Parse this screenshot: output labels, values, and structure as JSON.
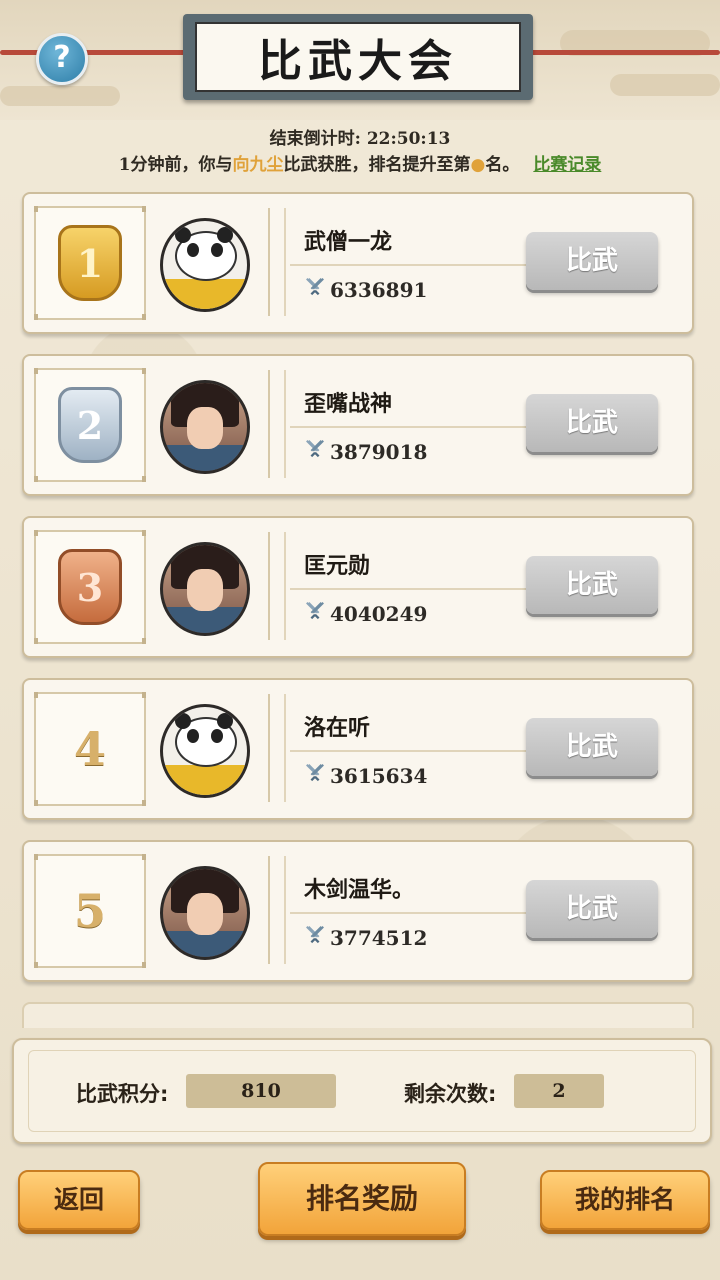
{
  "header": {
    "title": "比武大会",
    "help_label": "?"
  },
  "countdown": {
    "label": "结束倒计时:",
    "time": "22:50:13"
  },
  "notice": {
    "prefix": "1分钟前，你与",
    "opponent": "向九尘",
    "middle": "比武获胜，排名提升至第",
    "rank": "●",
    "suffix": "名。",
    "record_link": "比赛记录"
  },
  "ranking": [
    {
      "rank": "1",
      "medal": "gold",
      "avatar": "panda-avatar",
      "name": "武僧一龙",
      "power": "6336891",
      "button": "比武"
    },
    {
      "rank": "2",
      "medal": "silver",
      "avatar": "warrior-avatar",
      "name": "歪嘴战神",
      "power": "3879018",
      "button": "比武"
    },
    {
      "rank": "3",
      "medal": "bronze",
      "avatar": "swordswoman-avatar",
      "name": "匡元勋",
      "power": "4040249",
      "button": "比武"
    },
    {
      "rank": "4",
      "medal": "none",
      "avatar": "panda-avatar",
      "name": "洛在听",
      "power": "3615634",
      "button": "比武"
    },
    {
      "rank": "5",
      "medal": "none",
      "avatar": "swordsman-avatar",
      "name": "木剑温华。",
      "power": "3774512",
      "button": "比武"
    }
  ],
  "score_panel": {
    "points_label": "比武积分:",
    "points_value": "810",
    "remaining_label": "剩余次数:",
    "remaining_value": "2"
  },
  "buttons": {
    "back": "返回",
    "rank_rewards": "排名奖励",
    "my_rank": "我的排名"
  },
  "colors": {
    "highlight": "#e0a23a",
    "link": "#4a8a2a",
    "button_orange": "#f2a43a"
  }
}
